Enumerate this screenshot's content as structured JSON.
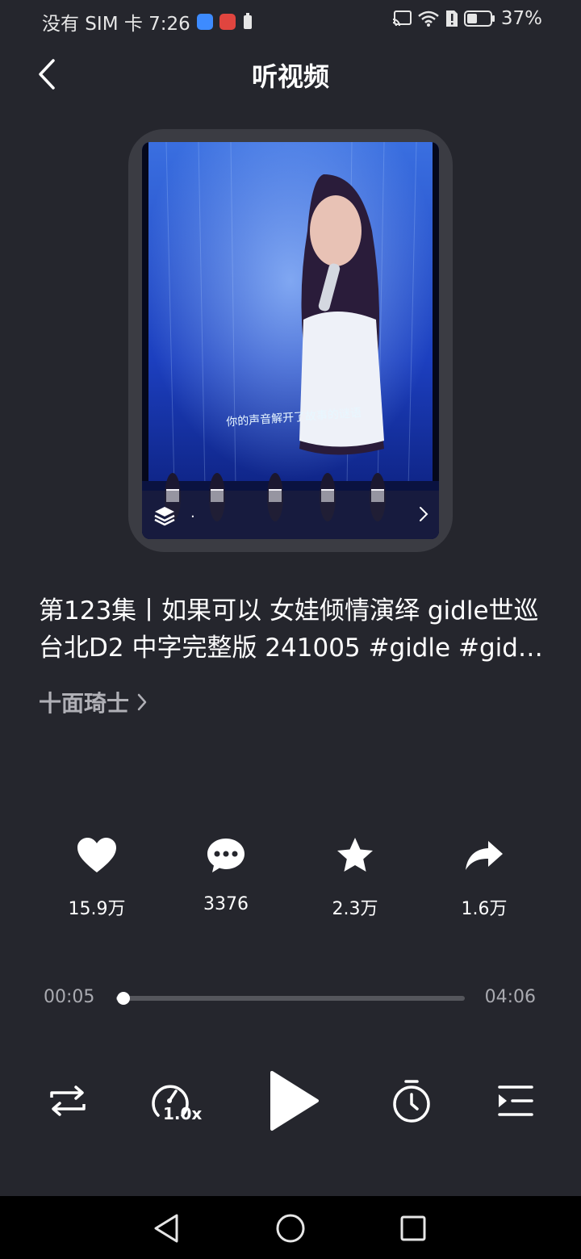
{
  "status_bar": {
    "carrier_time": "没有 SIM 卡 7:26",
    "battery": "37%"
  },
  "header": {
    "title": "听视频"
  },
  "cover": {
    "overlay_text": "·",
    "layers_icon": "layers-icon",
    "chevron_icon": "chevron-right-icon"
  },
  "video": {
    "title": "第123集丨如果可以  女娃倾情演绎  gidle世巡台北D2 中字完整版 241005 #gidle #gidle世巡",
    "author": "十面琦士"
  },
  "stats": [
    {
      "icon": "heart-icon",
      "value": "15.9万"
    },
    {
      "icon": "comment-icon",
      "value": "3376"
    },
    {
      "icon": "star-icon",
      "value": "2.3万"
    },
    {
      "icon": "share-icon",
      "value": "1.6万"
    }
  ],
  "player": {
    "current_time": "00:05",
    "total_time": "04:06",
    "progress": 0.02,
    "speed": "1.0x"
  },
  "colors": {
    "background": "#25262d",
    "cover_frame": "#3b3c43",
    "muted_text": "#a9aab0"
  }
}
